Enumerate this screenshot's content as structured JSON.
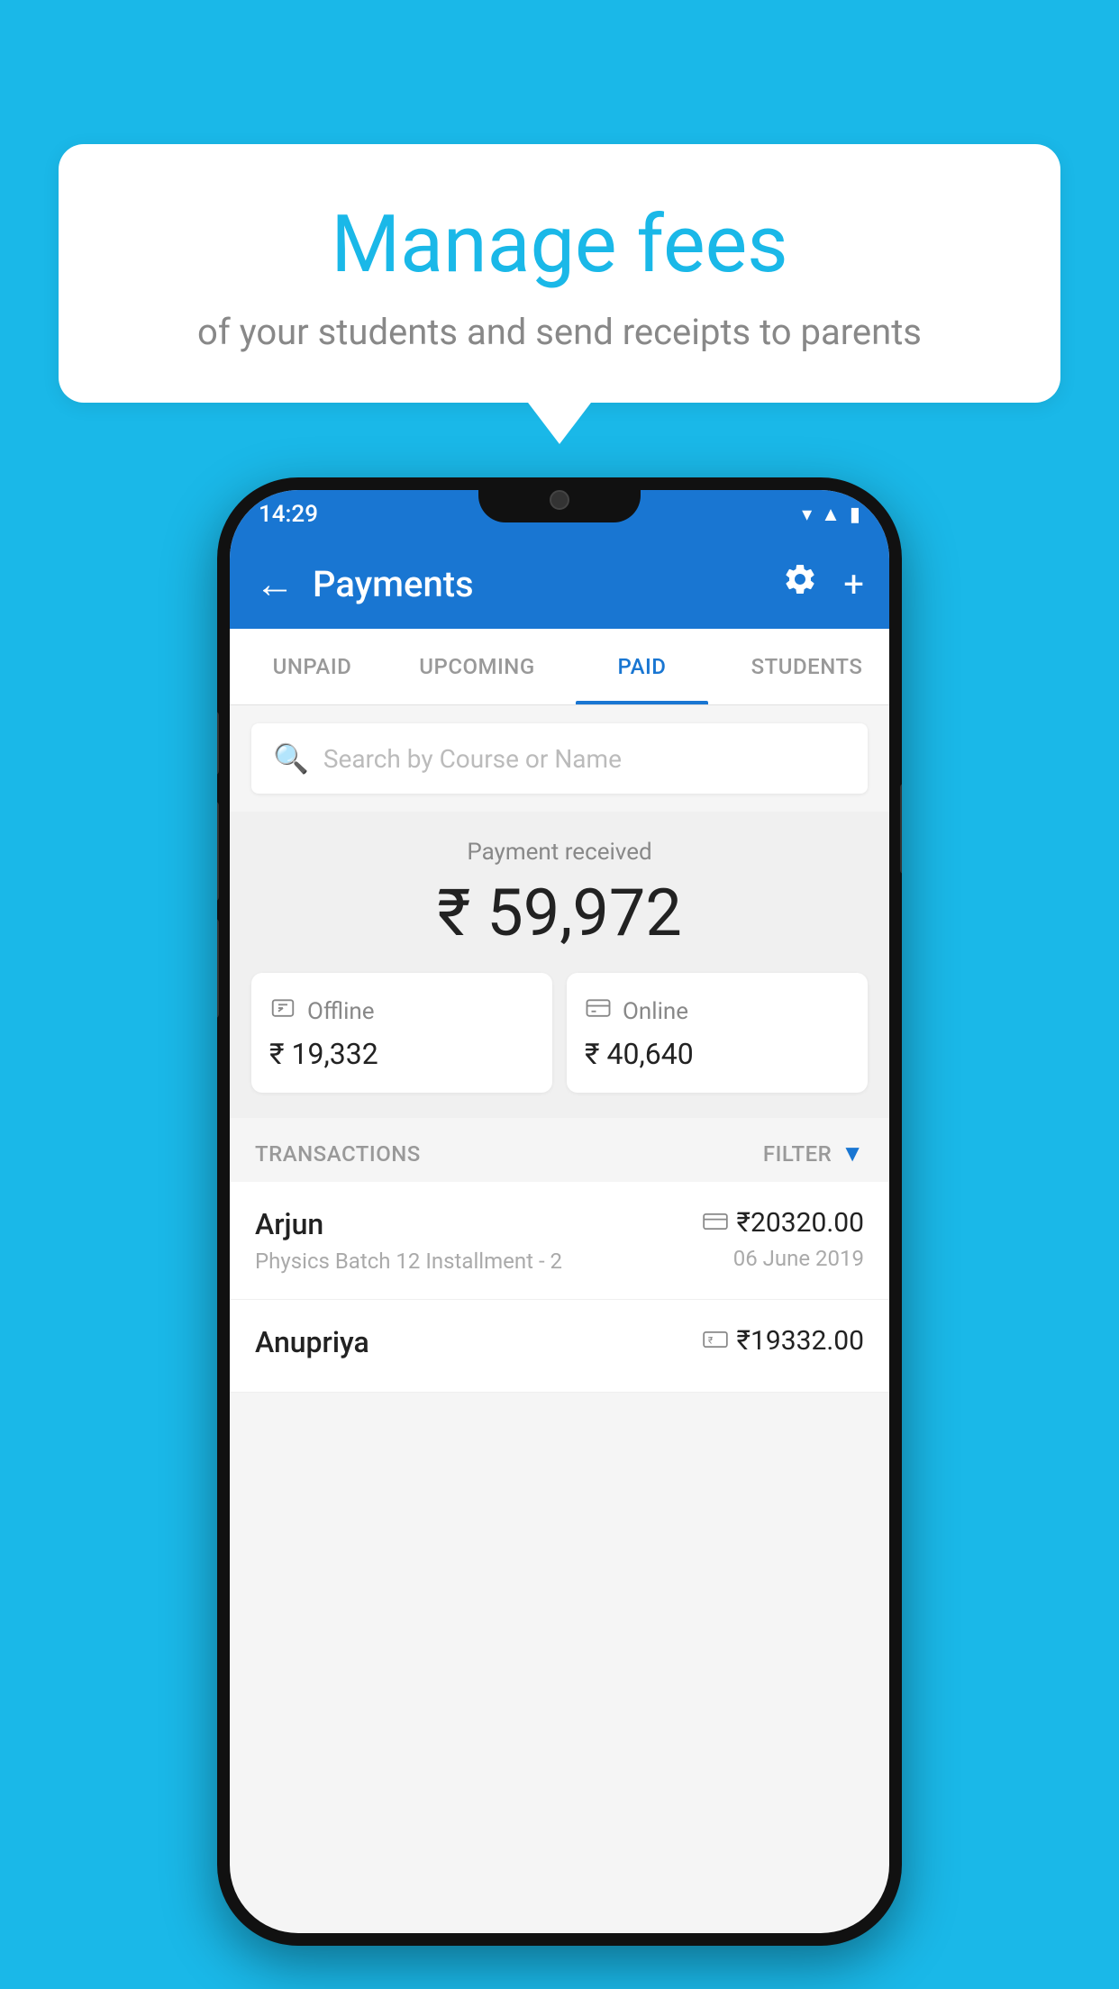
{
  "background_color": "#1ab8e8",
  "bubble": {
    "title": "Manage fees",
    "subtitle": "of your students and send receipts to parents"
  },
  "status_bar": {
    "time": "14:29",
    "icons": [
      "wifi",
      "signal",
      "battery"
    ]
  },
  "app_bar": {
    "title": "Payments",
    "back_label": "←",
    "settings_label": "⚙",
    "add_label": "+"
  },
  "tabs": [
    {
      "label": "UNPAID",
      "active": false
    },
    {
      "label": "UPCOMING",
      "active": false
    },
    {
      "label": "PAID",
      "active": true
    },
    {
      "label": "STUDENTS",
      "active": false
    }
  ],
  "search": {
    "placeholder": "Search by Course or Name"
  },
  "payment_summary": {
    "label": "Payment received",
    "amount": "₹ 59,972",
    "offline": {
      "icon": "offline-payment",
      "label": "Offline",
      "amount": "₹ 19,332"
    },
    "online": {
      "icon": "online-payment",
      "label": "Online",
      "amount": "₹ 40,640"
    }
  },
  "transactions": {
    "label": "TRANSACTIONS",
    "filter_label": "FILTER",
    "items": [
      {
        "name": "Arjun",
        "detail": "Physics Batch 12 Installment - 2",
        "payment_type": "online",
        "amount": "₹20320.00",
        "date": "06 June 2019"
      },
      {
        "name": "Anupriya",
        "detail": "",
        "payment_type": "offline",
        "amount": "₹19332.00",
        "date": ""
      }
    ]
  }
}
